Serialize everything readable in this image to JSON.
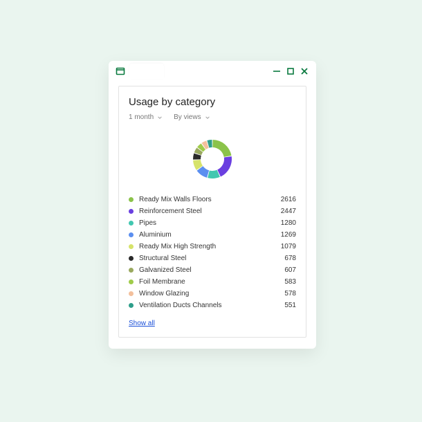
{
  "window": {
    "app_icon": "window-app-icon"
  },
  "card": {
    "title": "Usage by category",
    "filters": {
      "period": "1 month",
      "sort": "By views"
    },
    "show_all": "Show all"
  },
  "colors": {
    "green": "#8bc34a",
    "purple": "#6a3fe0",
    "teal": "#42c7b0",
    "blue": "#5b8ff0",
    "yellow": "#d6e36a",
    "black": "#2a2a2a",
    "olive": "#9aa95f",
    "lime": "#a0cc4a",
    "peach": "#f3c09c",
    "dteal": "#2e9e8a"
  },
  "legend": [
    {
      "label": "Ready Mix Walls Floors",
      "value": 2616,
      "colorKey": "green"
    },
    {
      "label": "Reinforcement Steel",
      "value": 2447,
      "colorKey": "purple"
    },
    {
      "label": "Pipes",
      "value": 1280,
      "colorKey": "teal"
    },
    {
      "label": "Aluminium",
      "value": 1269,
      "colorKey": "blue"
    },
    {
      "label": "Ready Mix High Strength",
      "value": 1079,
      "colorKey": "yellow"
    },
    {
      "label": "Structural Steel",
      "value": 678,
      "colorKey": "black"
    },
    {
      "label": "Galvanized Steel",
      "value": 607,
      "colorKey": "olive"
    },
    {
      "label": "Foil Membrane",
      "value": 583,
      "colorKey": "lime"
    },
    {
      "label": "Window Glazing",
      "value": 578,
      "colorKey": "peach"
    },
    {
      "label": "Ventilation Ducts Channels",
      "value": 551,
      "colorKey": "dteal"
    }
  ],
  "chart_data": {
    "type": "pie",
    "title": "Usage by category",
    "series": [
      {
        "name": "Ready Mix Walls Floors",
        "value": 2616,
        "color": "#8bc34a"
      },
      {
        "name": "Reinforcement Steel",
        "value": 2447,
        "color": "#6a3fe0"
      },
      {
        "name": "Pipes",
        "value": 1280,
        "color": "#42c7b0"
      },
      {
        "name": "Aluminium",
        "value": 1269,
        "color": "#5b8ff0"
      },
      {
        "name": "Ready Mix High Strength",
        "value": 1079,
        "color": "#d6e36a"
      },
      {
        "name": "Structural Steel",
        "value": 678,
        "color": "#2a2a2a"
      },
      {
        "name": "Galvanized Steel",
        "value": 607,
        "color": "#9aa95f"
      },
      {
        "name": "Foil Membrane",
        "value": 583,
        "color": "#a0cc4a"
      },
      {
        "name": "Window Glazing",
        "value": 578,
        "color": "#f3c09c"
      },
      {
        "name": "Ventilation Ducts Channels",
        "value": 551,
        "color": "#2e9e8a"
      }
    ]
  }
}
